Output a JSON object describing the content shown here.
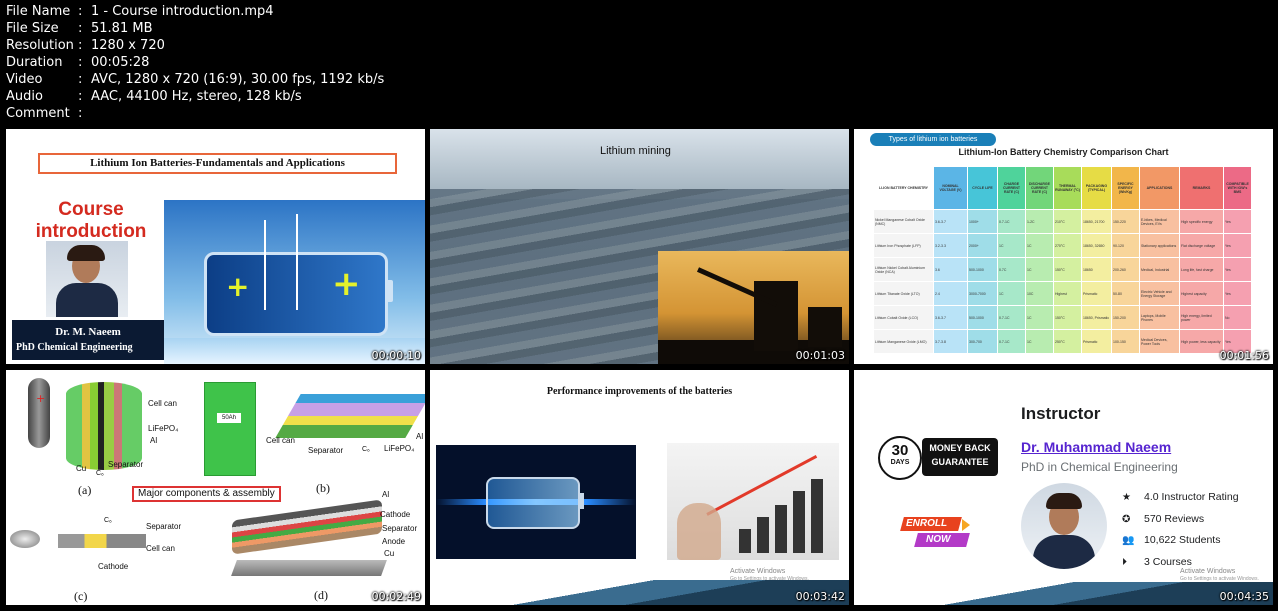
{
  "info": [
    {
      "key": "File Name",
      "value": "1 - Course introduction.mp4"
    },
    {
      "key": "File Size",
      "value": "51.81 MB"
    },
    {
      "key": "Resolution",
      "value": "1280 x 720"
    },
    {
      "key": "Duration",
      "value": "00:05:28"
    },
    {
      "key": "Video",
      "value": "AVC, 1280 x 720 (16:9), 30.00 fps, 1192 kb/s"
    },
    {
      "key": "Audio",
      "value": "AAC, 44100 Hz, stereo, 128 kb/s"
    },
    {
      "key": "Comment",
      "value": ""
    }
  ],
  "separator": ":",
  "thumbs": [
    {
      "time": "00:00:10",
      "title": "Lithium Ion Batteries-Fundamentals and Applications",
      "heading_line1": "Course",
      "heading_line2": "introduction",
      "name": "Dr. M. Naeem",
      "role": "PhD Chemical Engineering"
    },
    {
      "time": "00:01:03",
      "title": "Lithium mining"
    },
    {
      "time": "00:01:56",
      "tag": "Types of lithium ion batteries",
      "title": "Lithium-Ion Battery Chemistry Comparison Chart",
      "columns": [
        "LI-ION BATTERY CHEMISTRY",
        "NOMINAL VOLTAGE (V)",
        "CYCLE LIFE",
        "CHARGE CURRENT RATE (C)",
        "DISCHARGE CURRENT RATE (C)",
        "THERMAL RUNAWAY (°C)",
        "PACKAGING (TYPICAL)",
        "SPECIFIC ENERGY (Wh/Kg)",
        "APPLICATIONS",
        "REMARKS",
        "COMPATIBLE WITH IOW's BMS"
      ],
      "rows": [
        [
          "Nickel Manganese Cobalt Oxide (NMC)",
          "3.6-3.7",
          "1000+",
          "0.7-1C",
          "1-2C",
          "210°C",
          "18650, 21700",
          "150-220",
          "E-bikes, Medical Devices, EVs",
          "High specific energy",
          "Yes"
        ],
        [
          "Lithium Iron Phosphate (LFP)",
          "3.2-3.3",
          "2000+",
          "1C",
          "1C",
          "270°C",
          "18650, 32650",
          "90-120",
          "Stationary applications",
          "Flat discharge voltage",
          "Yes"
        ],
        [
          "Lithium Nickel Cobalt Aluminium Oxide (NCA)",
          "3.6",
          "500-1000",
          "0.7C",
          "1C",
          "150°C",
          "18650",
          "200-260",
          "Medical, Industrial",
          "Long life, fast charge",
          "Yes"
        ],
        [
          "Lithium Titanate Oxide (LTO)",
          "2.4",
          "3000-7000",
          "1C",
          "10C",
          "Highest",
          "Prismatic",
          "50-80",
          "Electric Vehicle and Energy Storage",
          "Highest capacity",
          "Yes"
        ],
        [
          "Lithium Cobalt Oxide (LCO)",
          "3.6-3.7",
          "500-1000",
          "0.7-1C",
          "1C",
          "150°C",
          "18650, Prismatic",
          "150-200",
          "Laptops, Mobile Phones",
          "High energy, limited power",
          "No"
        ],
        [
          "Lithium Manganese Oxide (LMO)",
          "3.7-3.8",
          "300-700",
          "0.7-1C",
          "1C",
          "250°C",
          "Prismatic",
          "100-150",
          "Medical Devices, Power Tools",
          "High power, less capacity",
          "Yes"
        ]
      ]
    },
    {
      "time": "00:02:49",
      "label_a": "(a)",
      "label_b": "(b)",
      "label_c": "(c)",
      "label_d": "(d)",
      "caption": "Major components & assembly",
      "cell_can": "Cell can",
      "lifepo4": "LiFePO₄",
      "al": "Al",
      "cu": "Cu",
      "c6": "C₆",
      "separator": "Separator",
      "cathode": "Cathode",
      "anode": "Anode",
      "badge": "50Ah"
    },
    {
      "time": "00:03:42",
      "title": "Performance improvements of the batteries",
      "watermark1": "Activate Windows",
      "watermark2": "Go to Settings to activate Windows."
    },
    {
      "time": "00:04:35",
      "heading": "Instructor",
      "name": "Dr. Muhammad Naeem",
      "role": "PhD in Chemical Engineering",
      "badge_days_num": "30",
      "badge_days": "DAYS",
      "badge_line1": "MONEY BACK",
      "badge_line2": "GUARANTEE",
      "enroll1": "ENROLL",
      "enroll2": "NOW",
      "stats": [
        {
          "icon": "star-icon",
          "text": "4.0 Instructor Rating"
        },
        {
          "icon": "award-icon",
          "text": "570 Reviews"
        },
        {
          "icon": "users-icon",
          "text": "10,622 Students"
        },
        {
          "icon": "play-icon",
          "text": "3 Courses"
        }
      ],
      "watermark1": "Activate Windows",
      "watermark2": "Go to Settings to activate Windows."
    }
  ]
}
